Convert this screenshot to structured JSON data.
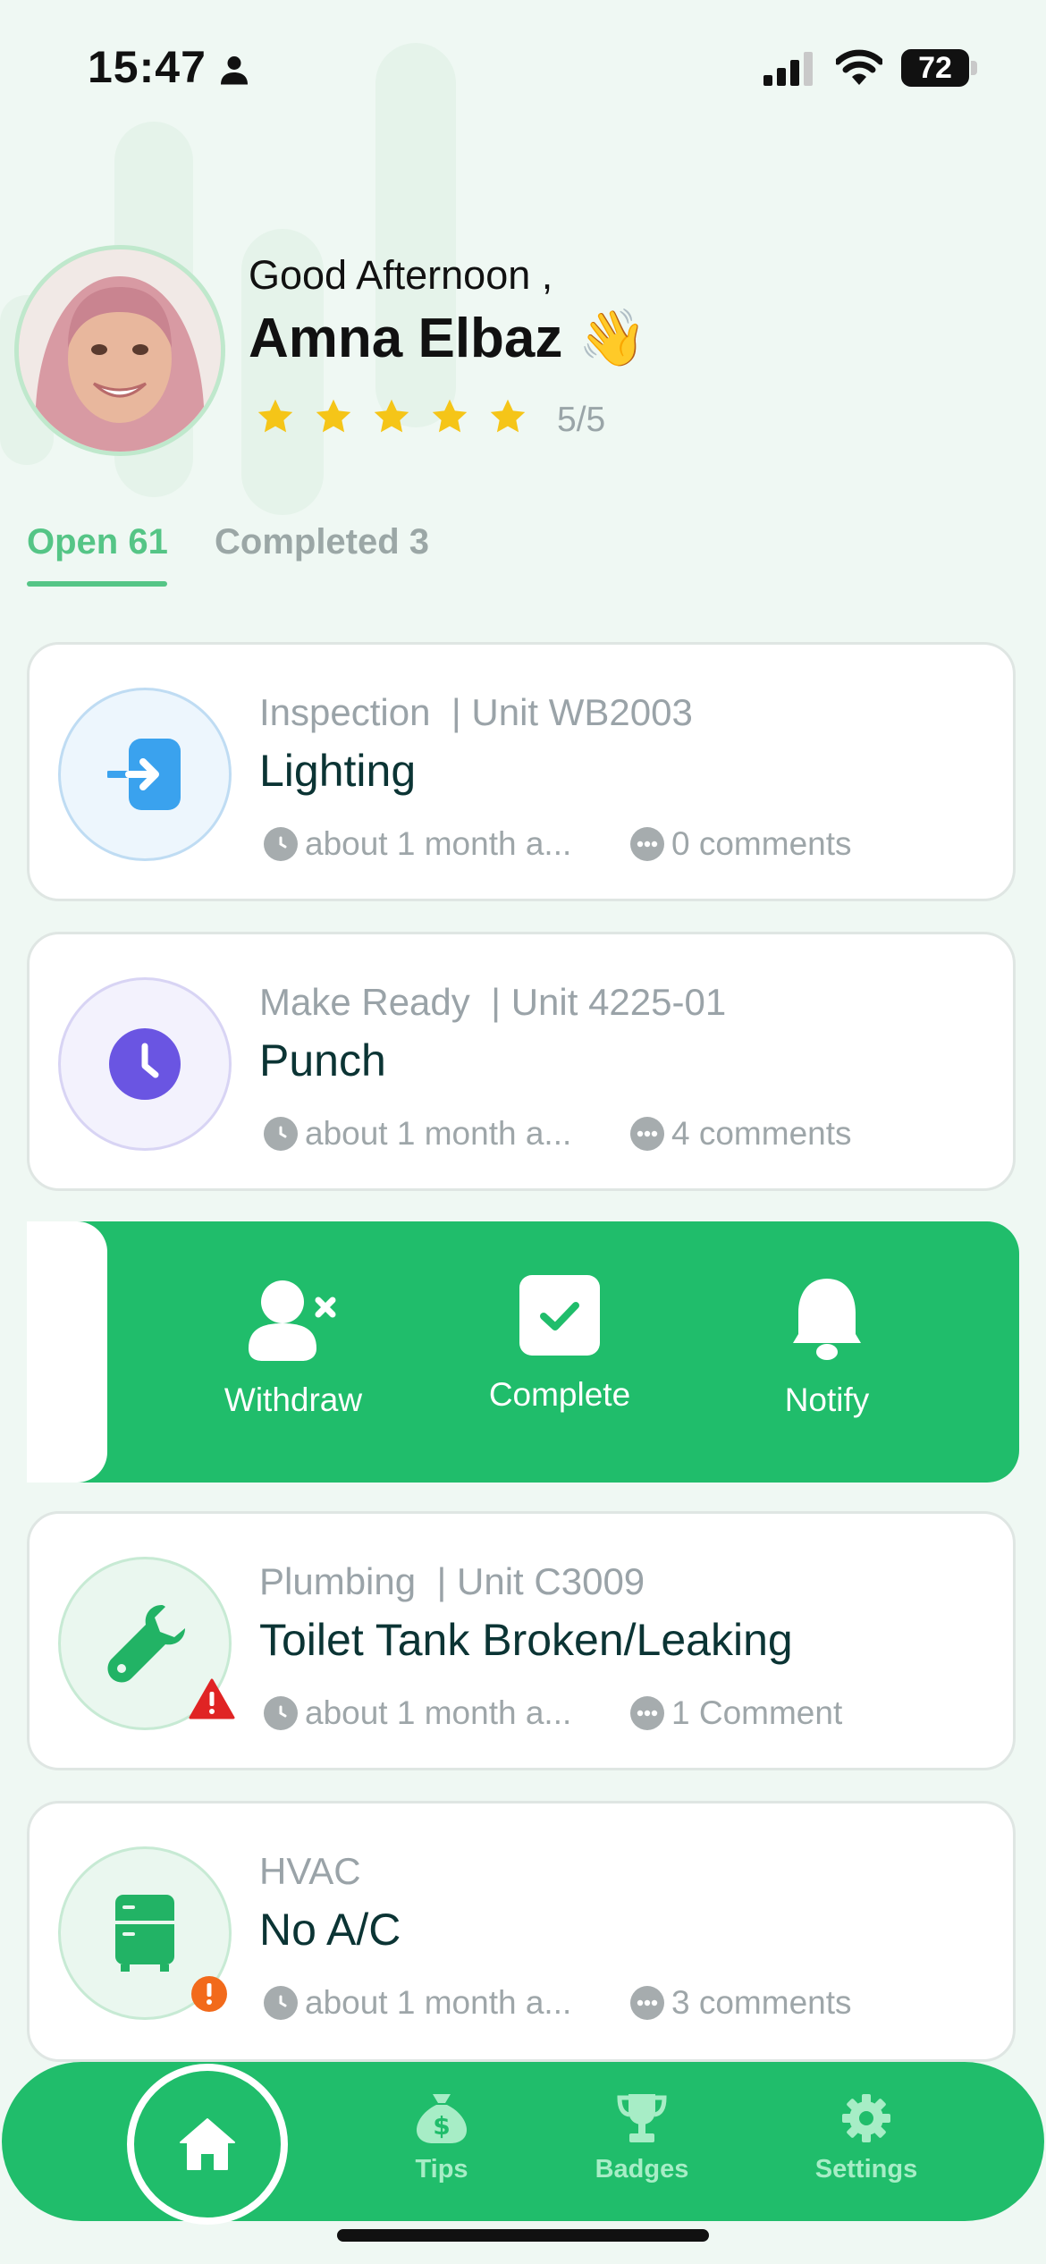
{
  "status_bar": {
    "time": "15:47",
    "battery": "72"
  },
  "user": {
    "greeting": "Good Afternoon ,",
    "name": "Amna Elbaz",
    "wave_emoji": "👋",
    "rating": 5,
    "rating_text": "5/5"
  },
  "tabs": [
    {
      "label": "Open 61",
      "active": true
    },
    {
      "label": "Completed 3",
      "active": false
    }
  ],
  "work_orders": [
    {
      "category": "Inspection",
      "unit": "| Unit WB2003",
      "title": "Lighting",
      "time": "about 1 month a...",
      "comments": "0 comments",
      "icon": "sign-in-icon",
      "icon_color": "#3aa2ee",
      "alert": null
    },
    {
      "category": "Make Ready",
      "unit": "| Unit 4225-01",
      "title": "Punch",
      "time": "about 1 month a...",
      "comments": "4 comments",
      "icon": "clock-icon",
      "icon_color": "#6a55e2",
      "alert": null
    },
    {
      "category": "Plumbing",
      "unit": "| Unit C3009",
      "title": "Toilet Tank Broken/Leaking",
      "time": "about 1 month a...",
      "comments": "1 Comment",
      "icon": "wrench-icon",
      "icon_color": "#22b365",
      "alert": "warning-triangle-icon"
    },
    {
      "category": "HVAC",
      "unit": "",
      "title": "No A/C",
      "time": "about 1 month a...",
      "comments": "3 comments",
      "icon": "fridge-icon",
      "icon_color": "#22b365",
      "alert": "orange-alert-icon"
    }
  ],
  "swipe_actions": [
    {
      "label": "Withdraw",
      "icon": "user-remove-icon"
    },
    {
      "label": "Complete",
      "icon": "check-box-icon"
    },
    {
      "label": "Notify",
      "icon": "bell-icon"
    }
  ],
  "bottom_nav": [
    {
      "label": "",
      "icon": "home-icon",
      "active": true
    },
    {
      "label": "Tips",
      "icon": "money-bag-icon"
    },
    {
      "label": "Badges",
      "icon": "trophy-icon"
    },
    {
      "label": "Settings",
      "icon": "gear-icon"
    }
  ],
  "colors": {
    "accent": "#20bd6b",
    "tab_active": "#55c586",
    "title_text": "#0b3434",
    "star": "#f5c518"
  }
}
